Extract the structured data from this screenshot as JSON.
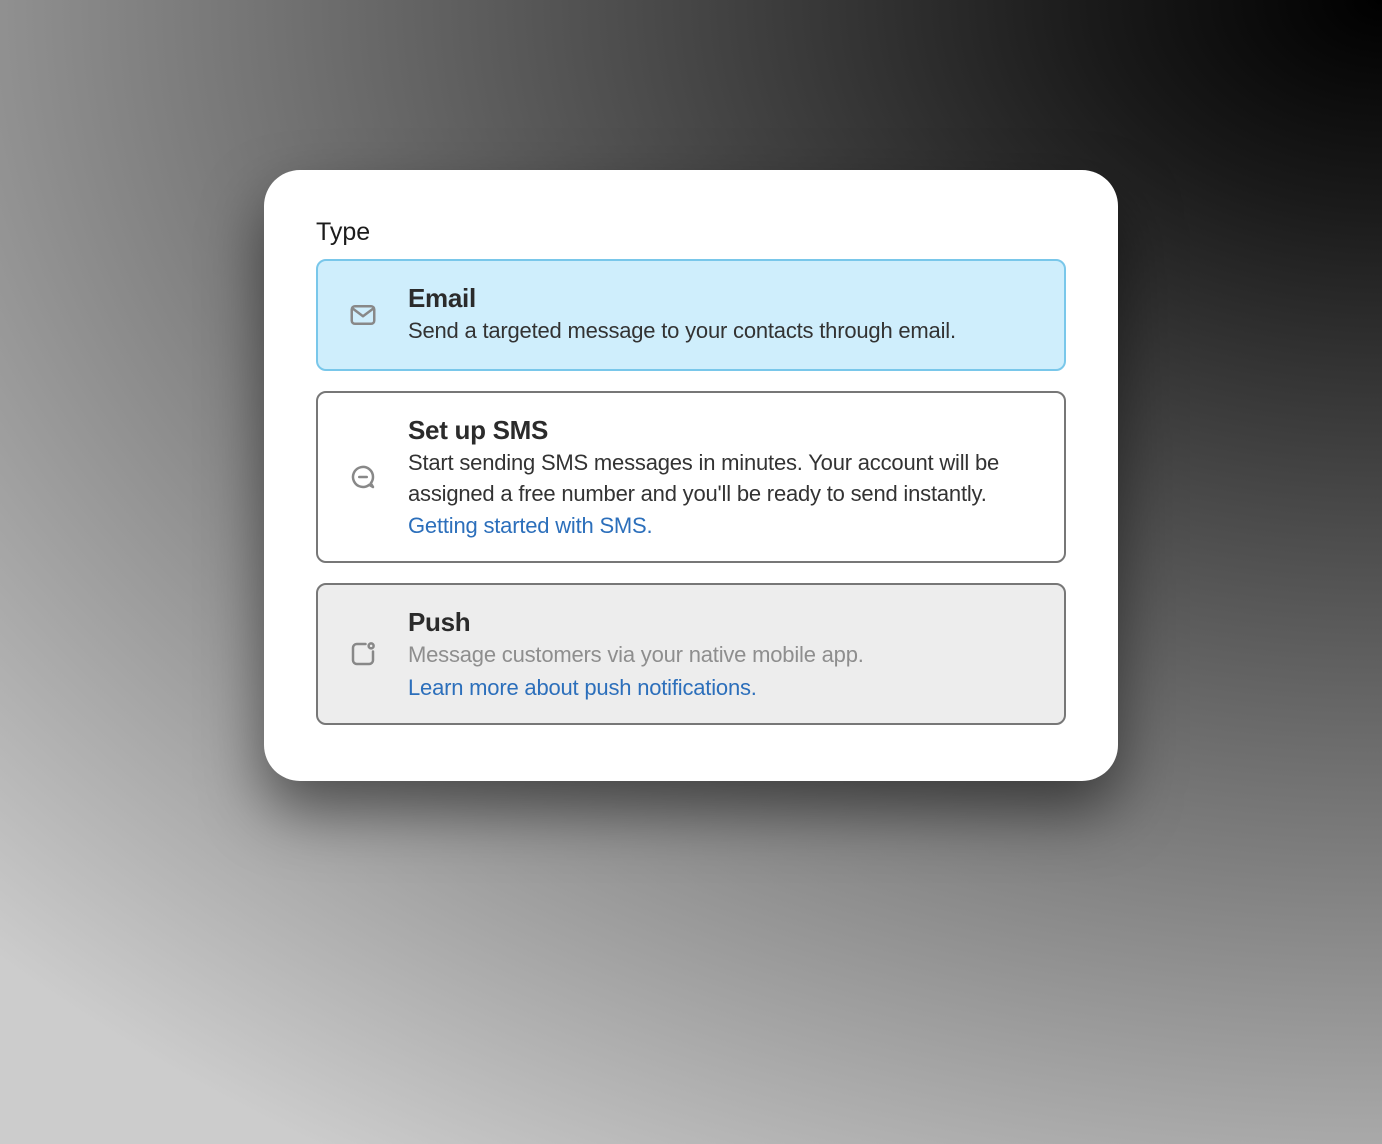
{
  "section_label": "Type",
  "options": {
    "email": {
      "title": "Email",
      "description": "Send a targeted message to your contacts through email."
    },
    "sms": {
      "title": "Set up SMS",
      "description": "Start sending SMS messages in minutes. Your account will be assigned a free number and you'll be ready to send instantly.",
      "link_text": "Getting started with SMS."
    },
    "push": {
      "title": "Push",
      "description": "Message customers via your native mobile app.",
      "link_text": "Learn more about push notifications."
    }
  }
}
